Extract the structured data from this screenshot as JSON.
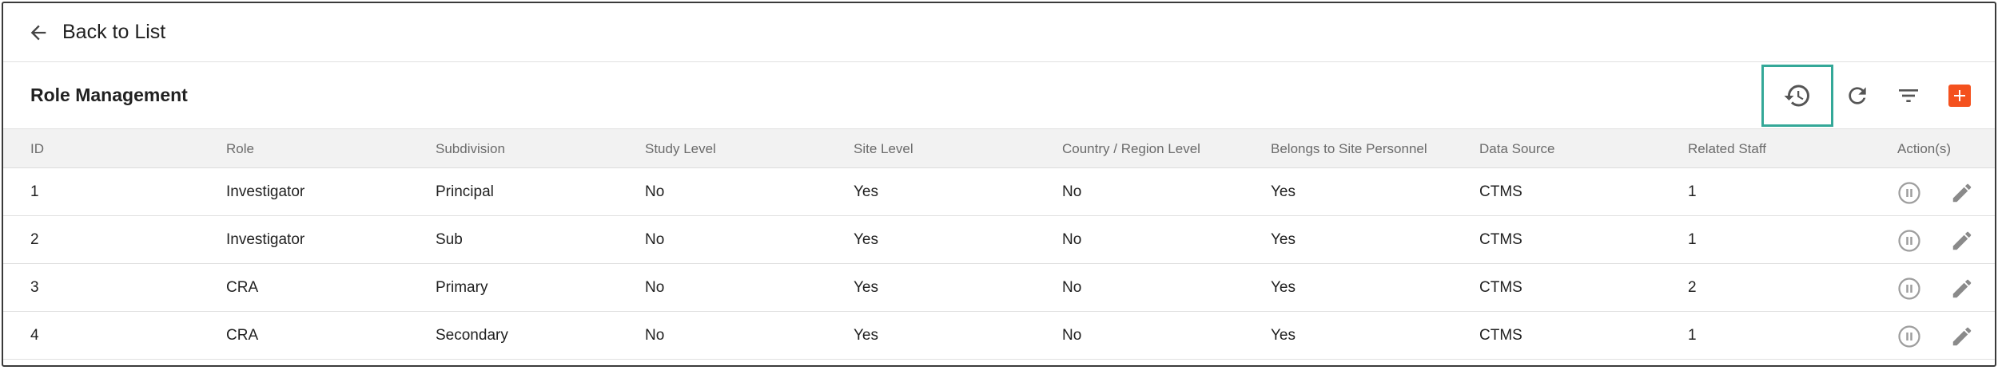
{
  "nav": {
    "back_label": "Back to List"
  },
  "header": {
    "title": "Role Management",
    "toolbar_icons": [
      "history-icon",
      "refresh-icon",
      "filter-icon",
      "add-icon"
    ]
  },
  "colors": {
    "accent_add": "#f4511e",
    "focus_outline": "#34a898",
    "header_bg": "#f2f2f2"
  },
  "table": {
    "columns": [
      "ID",
      "Role",
      "Subdivision",
      "Study Level",
      "Site Level",
      "Country / Region Level",
      "Belongs to Site Personnel",
      "Data Source",
      "Related Staff",
      "Action(s)"
    ],
    "rows": [
      {
        "id": "1",
        "role": "Investigator",
        "subdivision": "Principal",
        "study_level": "No",
        "site_level": "Yes",
        "country_region_level": "No",
        "belongs_to_site_personnel": "Yes",
        "data_source": "CTMS",
        "related_staff": "1",
        "actions": [
          "pause-icon",
          "edit-icon"
        ]
      },
      {
        "id": "2",
        "role": "Investigator",
        "subdivision": "Sub",
        "study_level": "No",
        "site_level": "Yes",
        "country_region_level": "No",
        "belongs_to_site_personnel": "Yes",
        "data_source": "CTMS",
        "related_staff": "1",
        "actions": [
          "pause-icon",
          "edit-icon"
        ]
      },
      {
        "id": "3",
        "role": "CRA",
        "subdivision": "Primary",
        "study_level": "No",
        "site_level": "Yes",
        "country_region_level": "No",
        "belongs_to_site_personnel": "Yes",
        "data_source": "CTMS",
        "related_staff": "2",
        "actions": [
          "pause-icon",
          "edit-icon"
        ]
      },
      {
        "id": "4",
        "role": "CRA",
        "subdivision": "Secondary",
        "study_level": "No",
        "site_level": "Yes",
        "country_region_level": "No",
        "belongs_to_site_personnel": "Yes",
        "data_source": "CTMS",
        "related_staff": "1",
        "actions": [
          "pause-icon",
          "edit-icon"
        ]
      }
    ]
  }
}
